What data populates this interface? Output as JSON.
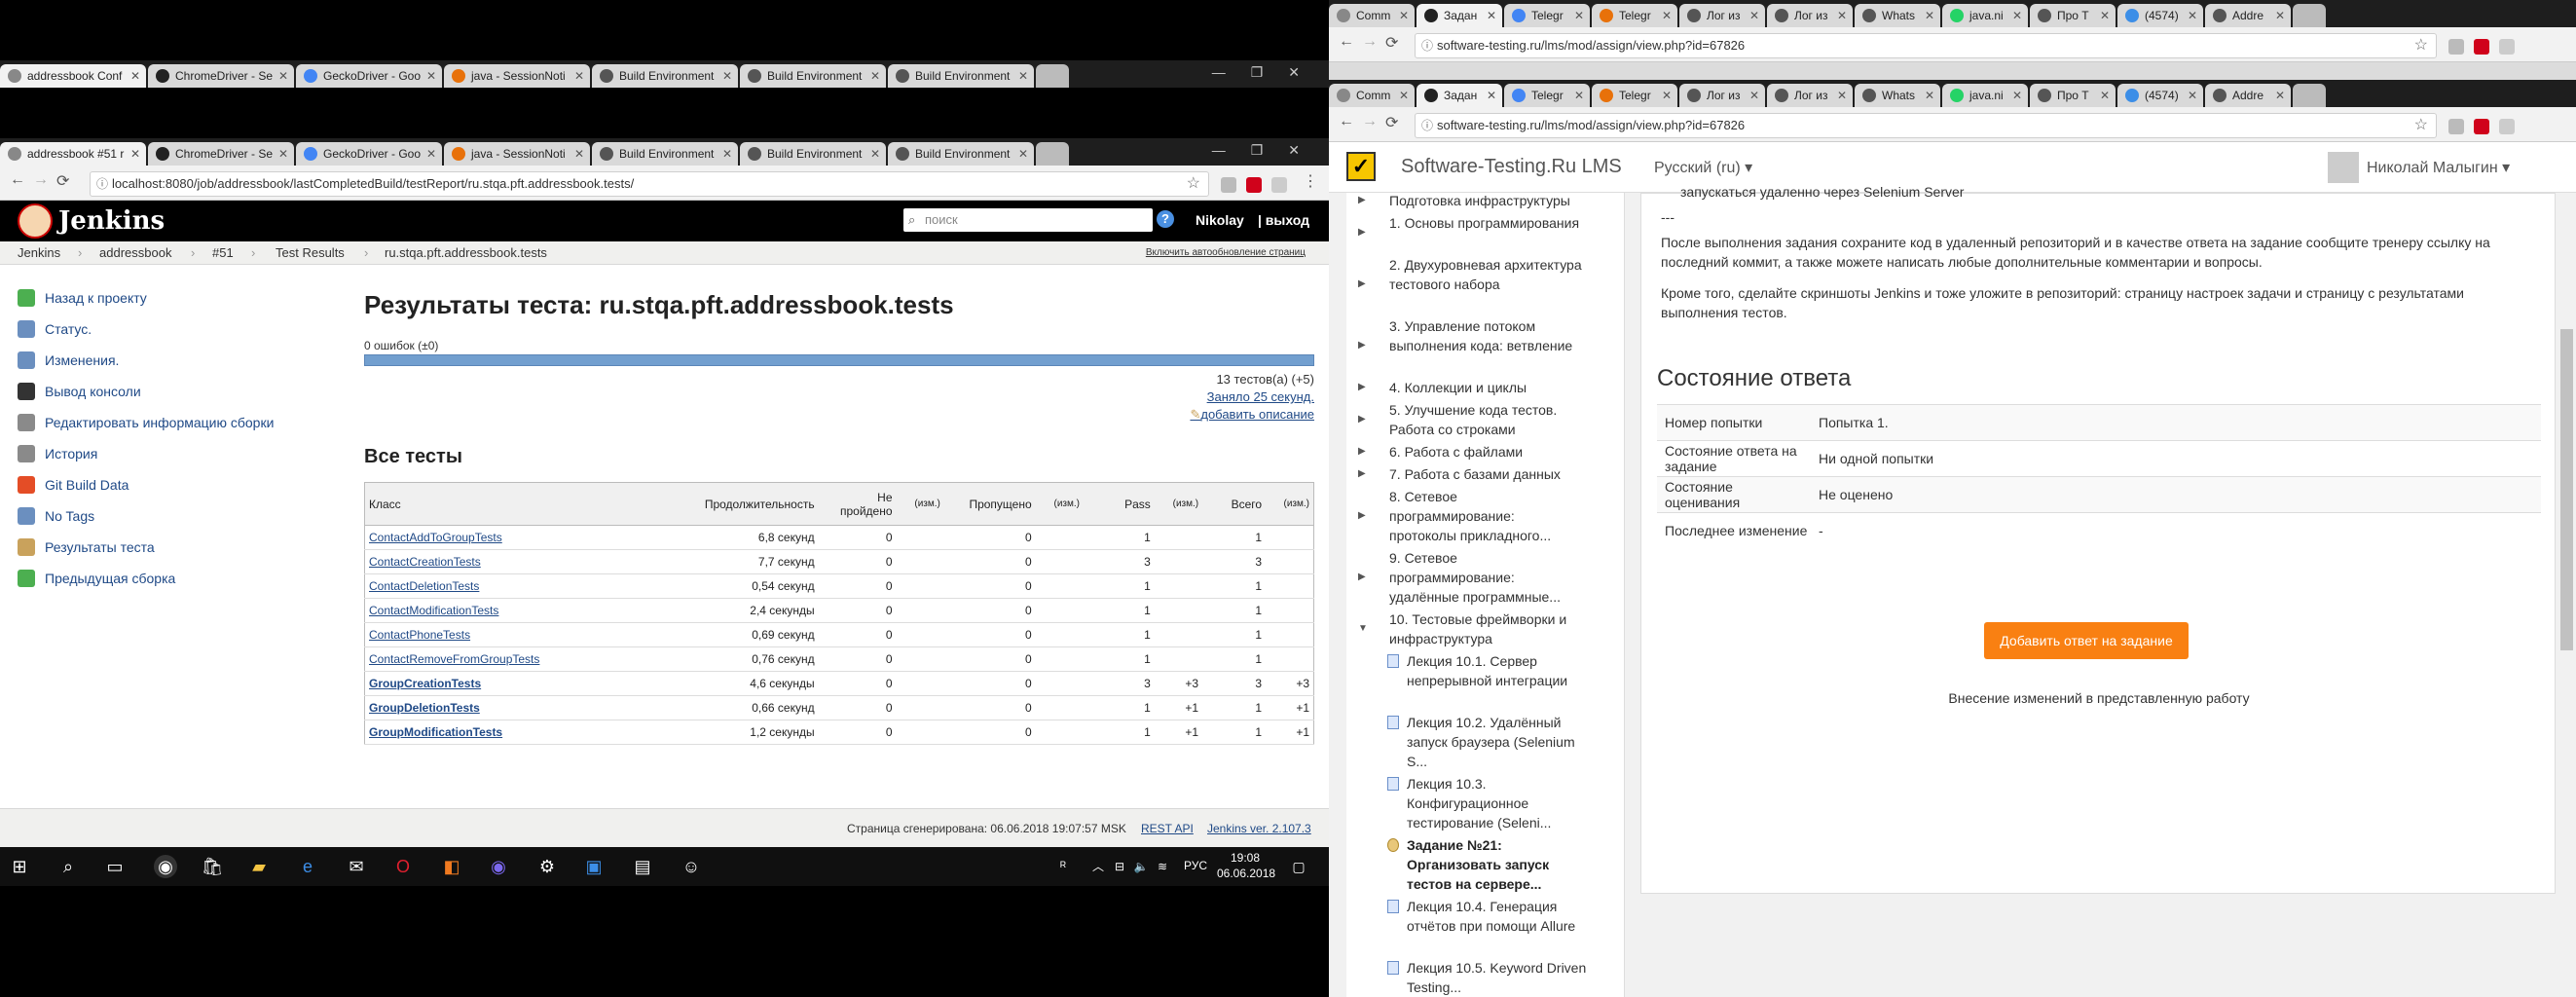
{
  "left_browser": {
    "top_tabs": [
      "addressbook Conf",
      "ChromeDriver - Se",
      "GeckoDriver - Goo",
      "java - SessionNoti",
      "Build Environment",
      "Build Environment",
      "Build Environment"
    ],
    "tabs": [
      "addressbook #51 r",
      "ChromeDriver - Se",
      "GeckoDriver - Goo",
      "java - SessionNoti",
      "Build Environment",
      "Build Environment",
      "Build Environment"
    ],
    "url": "localhost:8080/job/addressbook/lastCompletedBuild/testReport/ru.stqa.pft.addressbook.tests/"
  },
  "jenkins": {
    "brand": "Jenkins",
    "search_placeholder": "поиск",
    "help": "?",
    "user": "Nikolay",
    "logout": "| выход",
    "breadcrumb": [
      "Jenkins",
      "addressbook",
      "#51",
      "Test Results",
      "ru.stqa.pft.addressbook.tests"
    ],
    "breadcrumb_sep": "›",
    "auto_refresh": "Включить автообновление страниц",
    "side": [
      {
        "label": "Назад к проекту",
        "icon": "up-arrow-icon",
        "color": "#4caf50"
      },
      {
        "label": "Статус.",
        "icon": "magnifier-icon",
        "color": "#6b8fbf"
      },
      {
        "label": "Изменения.",
        "icon": "notepad-icon",
        "color": "#6b8fbf"
      },
      {
        "label": "Вывод консоли",
        "icon": "terminal-icon",
        "color": "#333333"
      },
      {
        "label": "Редактировать информацию сборки",
        "icon": "notepad-icon",
        "color": "#8a8a8a"
      },
      {
        "label": "История",
        "icon": "history-icon",
        "color": "#8a8a8a"
      },
      {
        "label": "Git Build Data",
        "icon": "git-icon",
        "color": "#e44d26"
      },
      {
        "label": "No Tags",
        "icon": "tag-icon",
        "color": "#6b8fbf"
      },
      {
        "label": "Результаты теста",
        "icon": "clipboard-icon",
        "color": "#c9a25c"
      },
      {
        "label": "Предыдущая сборка",
        "icon": "left-arrow-icon",
        "color": "#4caf50"
      }
    ],
    "title": "Результаты теста: ru.stqa.pft.addressbook.tests",
    "fails": "0 ошибок (±0)",
    "tests_count": "13 тестов(а) (+5)",
    "took": "Заняло 25 секунд.",
    "add_desc": "добавить описание",
    "all_tests": "Все тесты",
    "columns": [
      "Класс",
      "Продолжительность",
      "Не пройдено",
      "(изм.)",
      "Пропущено",
      "(изм.)",
      "Pass",
      "(изм.)",
      "Всего",
      "(изм.)"
    ],
    "rows": [
      {
        "name": "ContactAddToGroupTests",
        "dur": "6,8 секунд",
        "fail": "0",
        "fd": "",
        "skip": "0",
        "sd": "",
        "pass": "1",
        "pd": "",
        "total": "1",
        "td": "",
        "bold": false
      },
      {
        "name": "ContactCreationTests",
        "dur": "7,7 секунд",
        "fail": "0",
        "fd": "",
        "skip": "0",
        "sd": "",
        "pass": "3",
        "pd": "",
        "total": "3",
        "td": "",
        "bold": false
      },
      {
        "name": "ContactDeletionTests",
        "dur": "0,54 секунд",
        "fail": "0",
        "fd": "",
        "skip": "0",
        "sd": "",
        "pass": "1",
        "pd": "",
        "total": "1",
        "td": "",
        "bold": false
      },
      {
        "name": "ContactModificationTests",
        "dur": "2,4 секунды",
        "fail": "0",
        "fd": "",
        "skip": "0",
        "sd": "",
        "pass": "1",
        "pd": "",
        "total": "1",
        "td": "",
        "bold": false
      },
      {
        "name": "ContactPhoneTests",
        "dur": "0,69 секунд",
        "fail": "0",
        "fd": "",
        "skip": "0",
        "sd": "",
        "pass": "1",
        "pd": "",
        "total": "1",
        "td": "",
        "bold": false
      },
      {
        "name": "ContactRemoveFromGroupTests",
        "dur": "0,76 секунд",
        "fail": "0",
        "fd": "",
        "skip": "0",
        "sd": "",
        "pass": "1",
        "pd": "",
        "total": "1",
        "td": "",
        "bold": false
      },
      {
        "name": "GroupCreationTests",
        "dur": "4,6 секунды",
        "fail": "0",
        "fd": "",
        "skip": "0",
        "sd": "",
        "pass": "3",
        "pd": "+3",
        "total": "3",
        "td": "+3",
        "bold": true
      },
      {
        "name": "GroupDeletionTests",
        "dur": "0,66 секунд",
        "fail": "0",
        "fd": "",
        "skip": "0",
        "sd": "",
        "pass": "1",
        "pd": "+1",
        "total": "1",
        "td": "+1",
        "bold": true
      },
      {
        "name": "GroupModificationTests",
        "dur": "1,2 секунды",
        "fail": "0",
        "fd": "",
        "skip": "0",
        "sd": "",
        "pass": "1",
        "pd": "+1",
        "total": "1",
        "td": "+1",
        "bold": true
      }
    ],
    "pass_ratio": 1.0,
    "footer_generated": "Страница сгенерирована: 06.06.2018 19:07:57 MSK",
    "footer_rest": "REST API",
    "footer_ver": "Jenkins ver. 2.107.3"
  },
  "taskbar": {
    "time": "19:08",
    "date": "06.06.2018",
    "lang": "РУС"
  },
  "right_browser": {
    "top_tabs": [
      "Comm",
      "Задан",
      "Telegr",
      "Telegr",
      "Лог из",
      "Лог из",
      "Whats",
      "java.ni",
      "Про Т",
      "(4574)",
      "Addre"
    ],
    "tabs": [
      "Comm",
      "Задан",
      "Telegr",
      "Telegr",
      "Лог из",
      "Лог из",
      "Whats",
      "java.ni",
      "Про Т",
      "(4574)",
      "Addre"
    ],
    "url": "software-testing.ru/lms/mod/assign/view.php?id=67826"
  },
  "moodle": {
    "brand": "Software-Testing.Ru LMS",
    "lang": "Русский (ru) ▾",
    "user": "Николай Малыгин ▾",
    "nav": [
      {
        "label": "Подготовка инфраструктуры",
        "type": "section"
      },
      {
        "label": "1. Основы программирования",
        "type": "section"
      },
      {
        "label": "2. Двухуровневая архитектура тестового набора",
        "type": "section"
      },
      {
        "label": "3. Управление потоком выполнения кода: ветвление",
        "type": "section"
      },
      {
        "label": "4. Коллекции и циклы",
        "type": "section"
      },
      {
        "label": "5. Улучшение кода тестов. Работа со строками",
        "type": "section"
      },
      {
        "label": "6. Работа с файлами",
        "type": "section"
      },
      {
        "label": "7. Работа с базами данных",
        "type": "section"
      },
      {
        "label": "8. Сетевое программирование: протоколы прикладного...",
        "type": "section"
      },
      {
        "label": "9. Сетевое программирование: удалённые программные...",
        "type": "section"
      },
      {
        "label": "10. Тестовые фреймворки и инфраструктура",
        "type": "open"
      },
      {
        "label": "Лекция 10.1. Сервер непрерывной интеграции",
        "type": "page"
      },
      {
        "label": "Лекция 10.2. Удалённый запуск браузера (Selenium S...",
        "type": "page"
      },
      {
        "label": "Лекция 10.3. Конфигурационное тестирование (Seleni...",
        "type": "page"
      },
      {
        "label": "Задание №21: Организовать запуск тестов на сервере...",
        "type": "current"
      },
      {
        "label": "Лекция 10.4. Генерация отчётов при помощи Allure",
        "type": "page"
      },
      {
        "label": "Лекция 10.5. Keyword Driven Testing...",
        "type": "page"
      }
    ],
    "intro_fragment": "запускаться удаленно через Selenium Server",
    "dashes": "---",
    "p1": "После выполнения задания сохраните код в удаленный репозиторий и в качестве ответа на задание сообщите тренеру ссылку на последний коммит, а также можете написать любые дополнительные комментарии и вопросы.",
    "p2": "Кроме того, сделайте скриншоты Jenkins и тоже уложите в репозиторий: страницу настроек задачи и страницу с результатами выполнения тестов.",
    "status_title": "Состояние ответа",
    "status_rows": [
      {
        "k": "Номер попытки",
        "v": "Попытка 1."
      },
      {
        "k": "Состояние ответа на задание",
        "v": "Ни одной попытки"
      },
      {
        "k": "Состояние оценивания",
        "v": "Не оценено"
      },
      {
        "k": "Последнее изменение",
        "v": "-"
      }
    ],
    "add_button": "Добавить ответ на задание",
    "edit_note": "Внесение изменений в представленную работу"
  }
}
